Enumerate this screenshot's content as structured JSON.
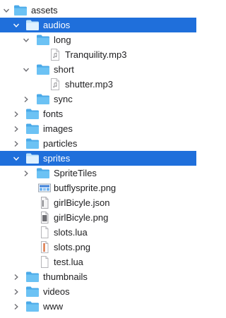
{
  "colors": {
    "selection": "#1f6fdb",
    "folder_fill": "#6cc2f4",
    "folder_tab": "#4aa9e8",
    "folder_selected_fill": "#dff1ff",
    "chevron": "#6e6e73",
    "file_fill": "#ffffff",
    "file_stroke": "#b5b5b9"
  },
  "tree": [
    {
      "label": "assets",
      "kind": "folder",
      "state": "expanded",
      "icon": "folder-icon"
    },
    {
      "label": "audios",
      "kind": "folder",
      "state": "expanded",
      "selected": true,
      "icon": "folder-icon"
    },
    {
      "label": "long",
      "kind": "folder",
      "state": "expanded",
      "icon": "folder-icon"
    },
    {
      "label": "Tranquility.mp3",
      "kind": "file",
      "icon": "audio-file-icon"
    },
    {
      "label": "short",
      "kind": "folder",
      "state": "expanded",
      "icon": "folder-icon"
    },
    {
      "label": "shutter.mp3",
      "kind": "file",
      "icon": "audio-file-icon"
    },
    {
      "label": "sync",
      "kind": "folder",
      "state": "collapsed",
      "icon": "folder-icon"
    },
    {
      "label": "fonts",
      "kind": "folder",
      "state": "collapsed",
      "icon": "folder-icon"
    },
    {
      "label": "images",
      "kind": "folder",
      "state": "collapsed",
      "icon": "folder-icon"
    },
    {
      "label": "particles",
      "kind": "folder",
      "state": "collapsed",
      "icon": "folder-icon"
    },
    {
      "label": "sprites",
      "kind": "folder",
      "state": "expanded",
      "selected": true,
      "icon": "folder-icon"
    },
    {
      "label": "SpriteTiles",
      "kind": "folder",
      "state": "collapsed",
      "icon": "folder-icon"
    },
    {
      "label": "butflysprite.png",
      "kind": "file",
      "icon": "image-file-icon"
    },
    {
      "label": "girlBicyle.json",
      "kind": "file",
      "icon": "json-file-icon"
    },
    {
      "label": "girlBicyle.png",
      "kind": "file",
      "icon": "image-file-icon"
    },
    {
      "label": "slots.lua",
      "kind": "file",
      "icon": "text-file-icon"
    },
    {
      "label": "slots.png",
      "kind": "file",
      "icon": "image-file-icon"
    },
    {
      "label": "test.lua",
      "kind": "file",
      "icon": "text-file-icon"
    },
    {
      "label": "thumbnails",
      "kind": "folder",
      "state": "collapsed",
      "icon": "folder-icon"
    },
    {
      "label": "videos",
      "kind": "folder",
      "state": "collapsed",
      "icon": "folder-icon"
    },
    {
      "label": "www",
      "kind": "folder",
      "state": "collapsed",
      "icon": "folder-icon"
    }
  ]
}
